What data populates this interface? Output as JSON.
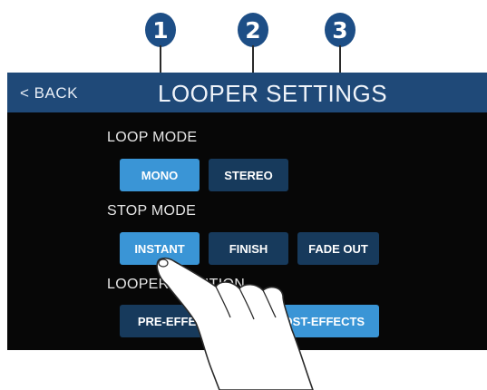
{
  "callouts": [
    "1",
    "2",
    "3"
  ],
  "header": {
    "back_label": "< BACK",
    "title": "LOOPER SETTINGS"
  },
  "loop_mode": {
    "label": "LOOP MODE",
    "options": [
      {
        "label": "MONO",
        "selected": true
      },
      {
        "label": "STEREO",
        "selected": false
      }
    ]
  },
  "stop_mode": {
    "label": "STOP MODE",
    "options": [
      {
        "label": "INSTANT",
        "selected": true
      },
      {
        "label": "FINISH",
        "selected": false
      },
      {
        "label": "FADE OUT",
        "selected": false
      }
    ]
  },
  "looper_position": {
    "label": "LOOPER POSITION",
    "options": [
      {
        "label": "PRE-EFFECTS",
        "selected": false
      },
      {
        "label": "POST-EFFECTS",
        "selected": true
      }
    ]
  },
  "colors": {
    "header_bg": "#1f4978",
    "button_selected": "#3a95d6",
    "button_unselected": "#173a5c",
    "callout": "#1d4e86"
  },
  "icons": [
    "finger-tap-hand-icon"
  ]
}
